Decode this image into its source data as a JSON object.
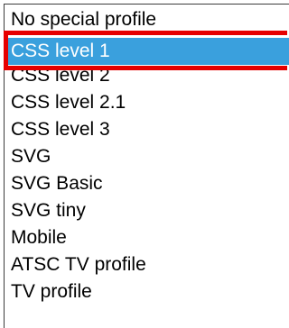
{
  "profile_list": {
    "options": [
      {
        "label": "No special profile",
        "selected": false
      },
      {
        "label": "CSS level 1",
        "selected": true
      },
      {
        "label": "CSS level 2",
        "selected": false
      },
      {
        "label": "CSS level 2.1",
        "selected": false
      },
      {
        "label": "CSS level 3",
        "selected": false
      },
      {
        "label": "SVG",
        "selected": false
      },
      {
        "label": "SVG Basic",
        "selected": false
      },
      {
        "label": "SVG tiny",
        "selected": false
      },
      {
        "label": "Mobile",
        "selected": false
      },
      {
        "label": "ATSC TV profile",
        "selected": false
      },
      {
        "label": "TV profile",
        "selected": false
      }
    ]
  },
  "colors": {
    "selection_background": "#3aa0dd",
    "selection_text": "#ffffff",
    "highlight_border": "#e60000",
    "list_border": "#3c3c3c"
  }
}
